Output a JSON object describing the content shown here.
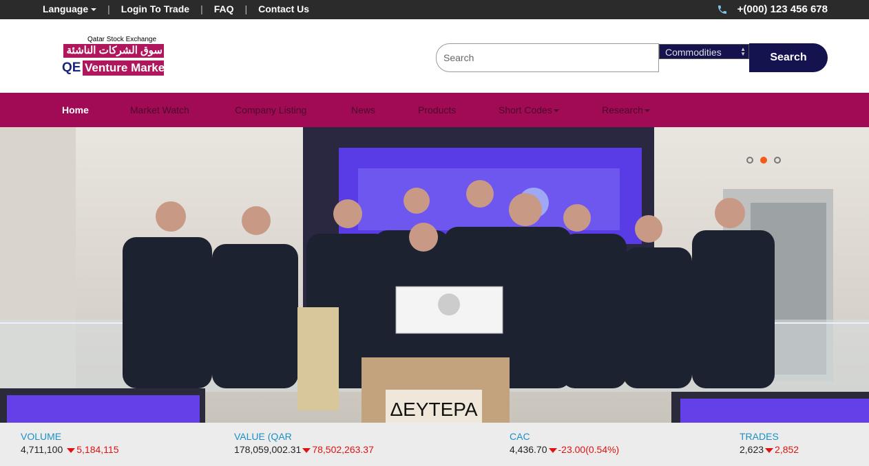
{
  "topbar": {
    "language": "Language",
    "login": "Login To Trade",
    "faq": "FAQ",
    "contact": "Contact Us",
    "separator": "|",
    "phone": "+(000) 123 456 678"
  },
  "logo": {
    "exchange": "Qatar Stock Exchange",
    "arabic": "سوق الشركات الناشئة",
    "qe": "QE",
    "venture": "Venture Market"
  },
  "search": {
    "placeholder": "Search",
    "category": "Commodities",
    "button": "Search"
  },
  "nav": {
    "items": [
      "Home",
      "Market Watch",
      "Company Listing",
      "News",
      "Products",
      "Short Codes",
      "Research"
    ]
  },
  "hero": {
    "podium_text": "ΔΕΥΤΕΡΑ",
    "slides": 3,
    "active_slide": 2
  },
  "ticker": [
    {
      "label": "VOLUME",
      "value": "4,711,100",
      "change": "5,184,115"
    },
    {
      "label": "VALUE (QAR",
      "value": "178,059,002.31",
      "change": "78,502,263.37"
    },
    {
      "label": "CAC",
      "value": "4,436.70",
      "change": "-23.00(0.54%)"
    },
    {
      "label": "TRADES",
      "value": "2,623",
      "change": "2,852"
    }
  ],
  "colors": {
    "brand_magenta": "#a10b56",
    "brand_navy": "#14134f",
    "topbar": "#2b2b2b",
    "down_red": "#e21111",
    "label_blue": "#1b8fc4"
  }
}
